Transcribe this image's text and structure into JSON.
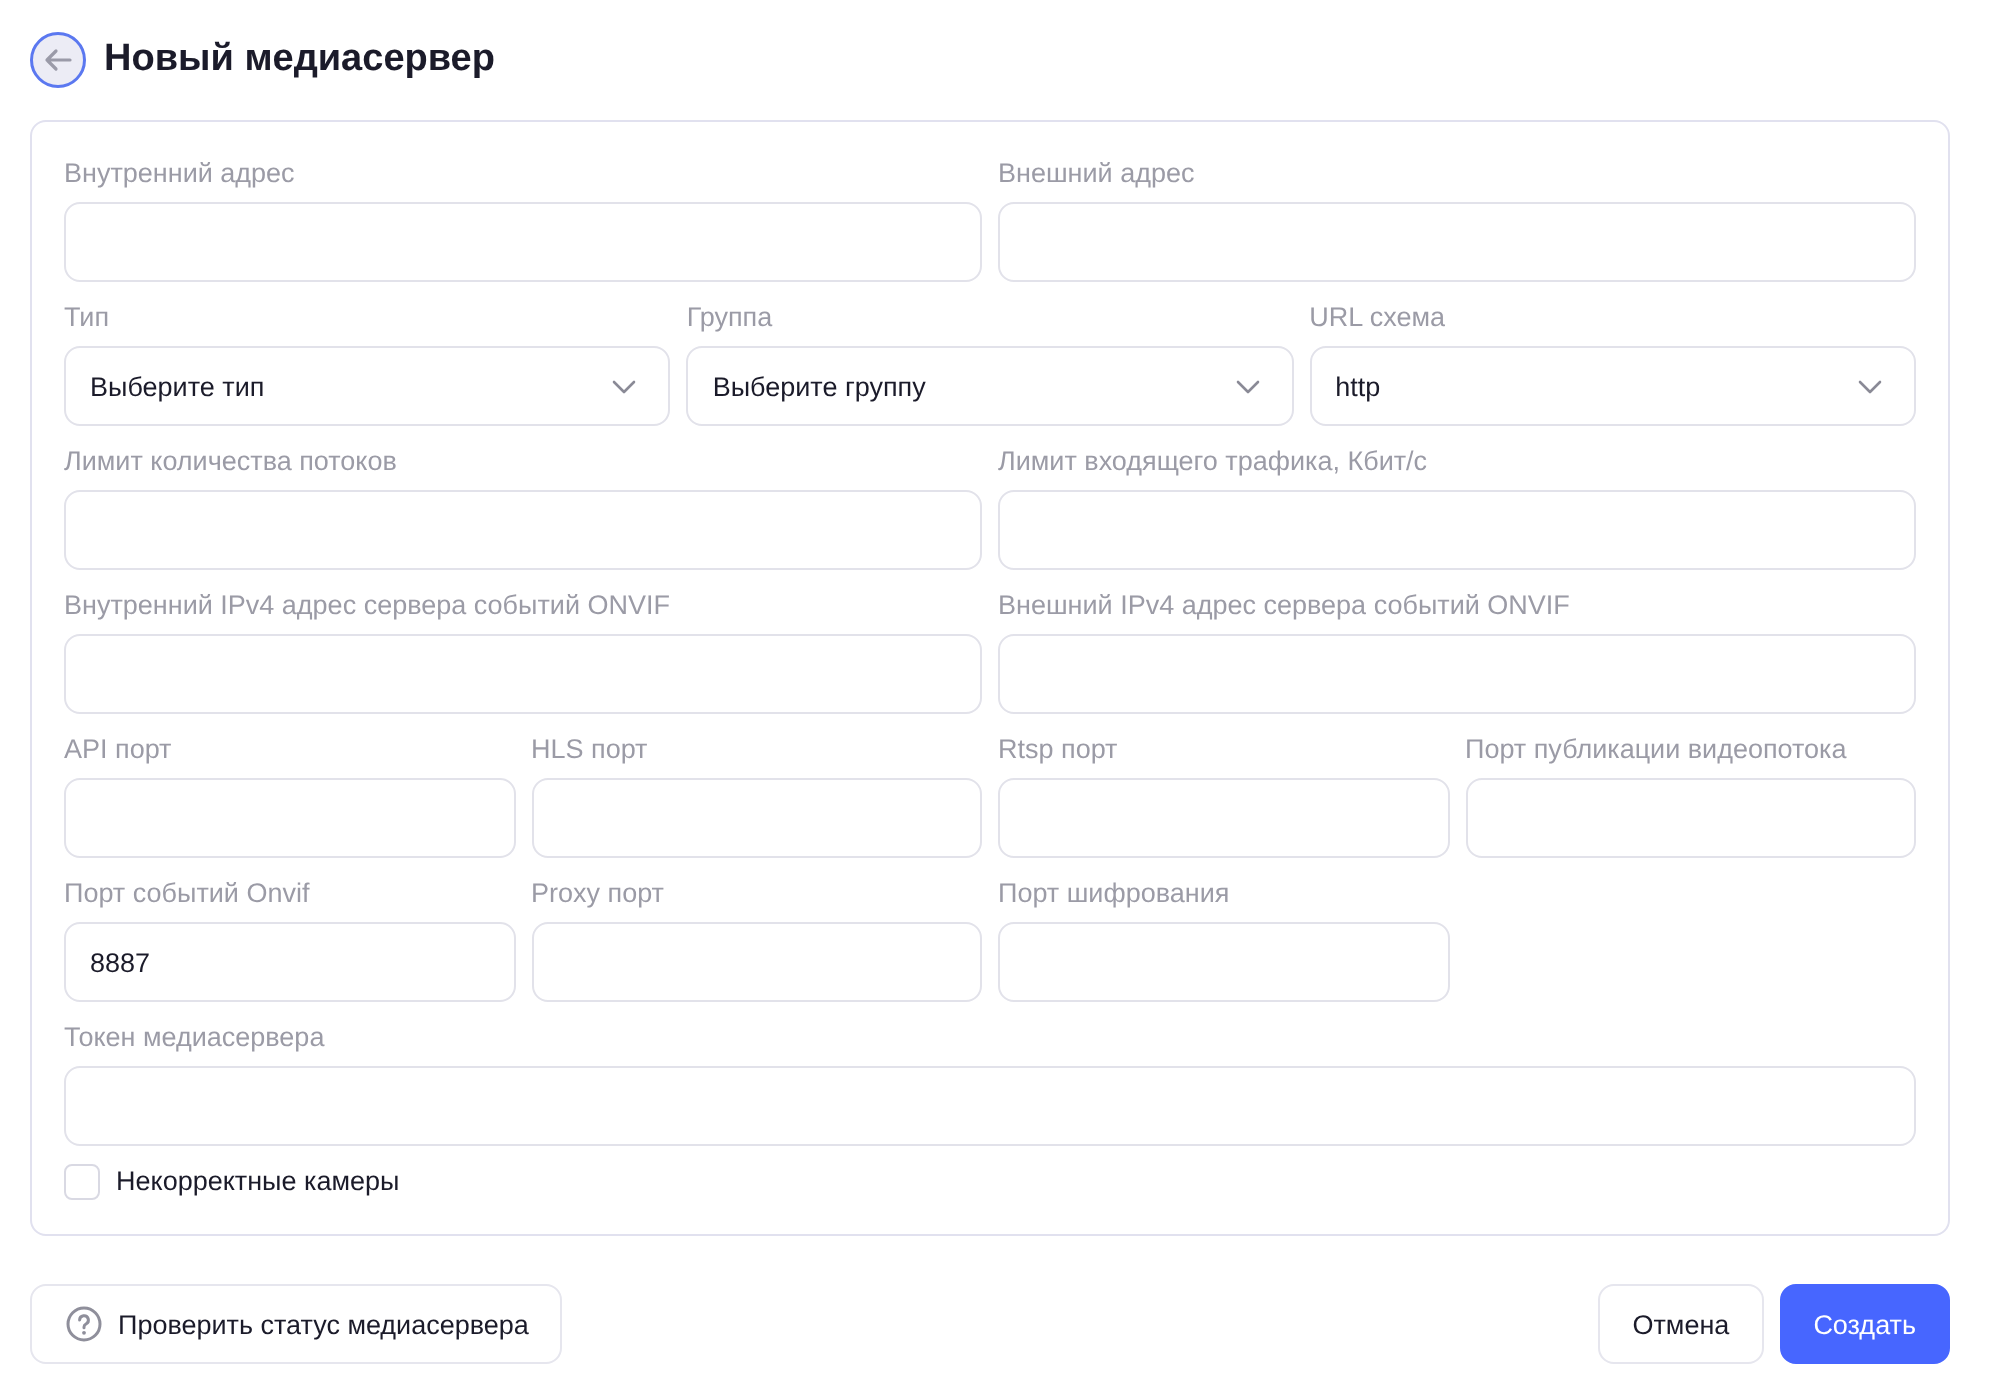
{
  "header": {
    "title": "Новый медиасервер"
  },
  "form": {
    "sections": [
      {
        "fields": [
          {
            "kind": "text",
            "label": "Внутренний адрес"
          },
          {
            "kind": "text",
            "label": "Внешний адрес"
          }
        ]
      },
      {
        "fields": [
          {
            "kind": "select",
            "label": "Тип",
            "placeholder": "Выберите тип"
          },
          {
            "kind": "select",
            "label": "Группа",
            "placeholder": "Выберите группу"
          },
          {
            "kind": "select",
            "label": "URL схема",
            "value": "http"
          }
        ]
      },
      {
        "fields": [
          {
            "kind": "text",
            "label": "Лимит количества потоков"
          },
          {
            "kind": "text",
            "label": "Лимит входящего трафика, Кбит/с"
          }
        ]
      },
      {
        "fields": [
          {
            "kind": "text",
            "label": "Внутренний IPv4 адрес сервера событий ONVIF"
          },
          {
            "kind": "text",
            "label": "Внешний IPv4 адрес сервера событий ONVIF"
          }
        ]
      },
      {
        "fields": [
          {
            "kind": "text",
            "label": "API порт"
          },
          {
            "kind": "text",
            "label": "HLS порт"
          },
          {
            "kind": "text",
            "label": "Rtsp порт"
          },
          {
            "kind": "text",
            "label": "Порт публикации видеопотока"
          },
          {
            "kind": "text",
            "label": "Порт событий Onvif",
            "value": "8887"
          },
          {
            "kind": "text",
            "label": "Proxy порт"
          },
          {
            "kind": "text",
            "label": "Порт шифрования"
          }
        ]
      },
      {
        "fields": [
          {
            "kind": "text",
            "label": "Токен медиасервера"
          }
        ]
      }
    ],
    "checkbox": {
      "label": "Некорректные камеры",
      "checked": false
    }
  },
  "footer": {
    "status_button": "Проверить статус медиасервера",
    "cancel_button": "Отмена",
    "create_button": "Создать"
  }
}
